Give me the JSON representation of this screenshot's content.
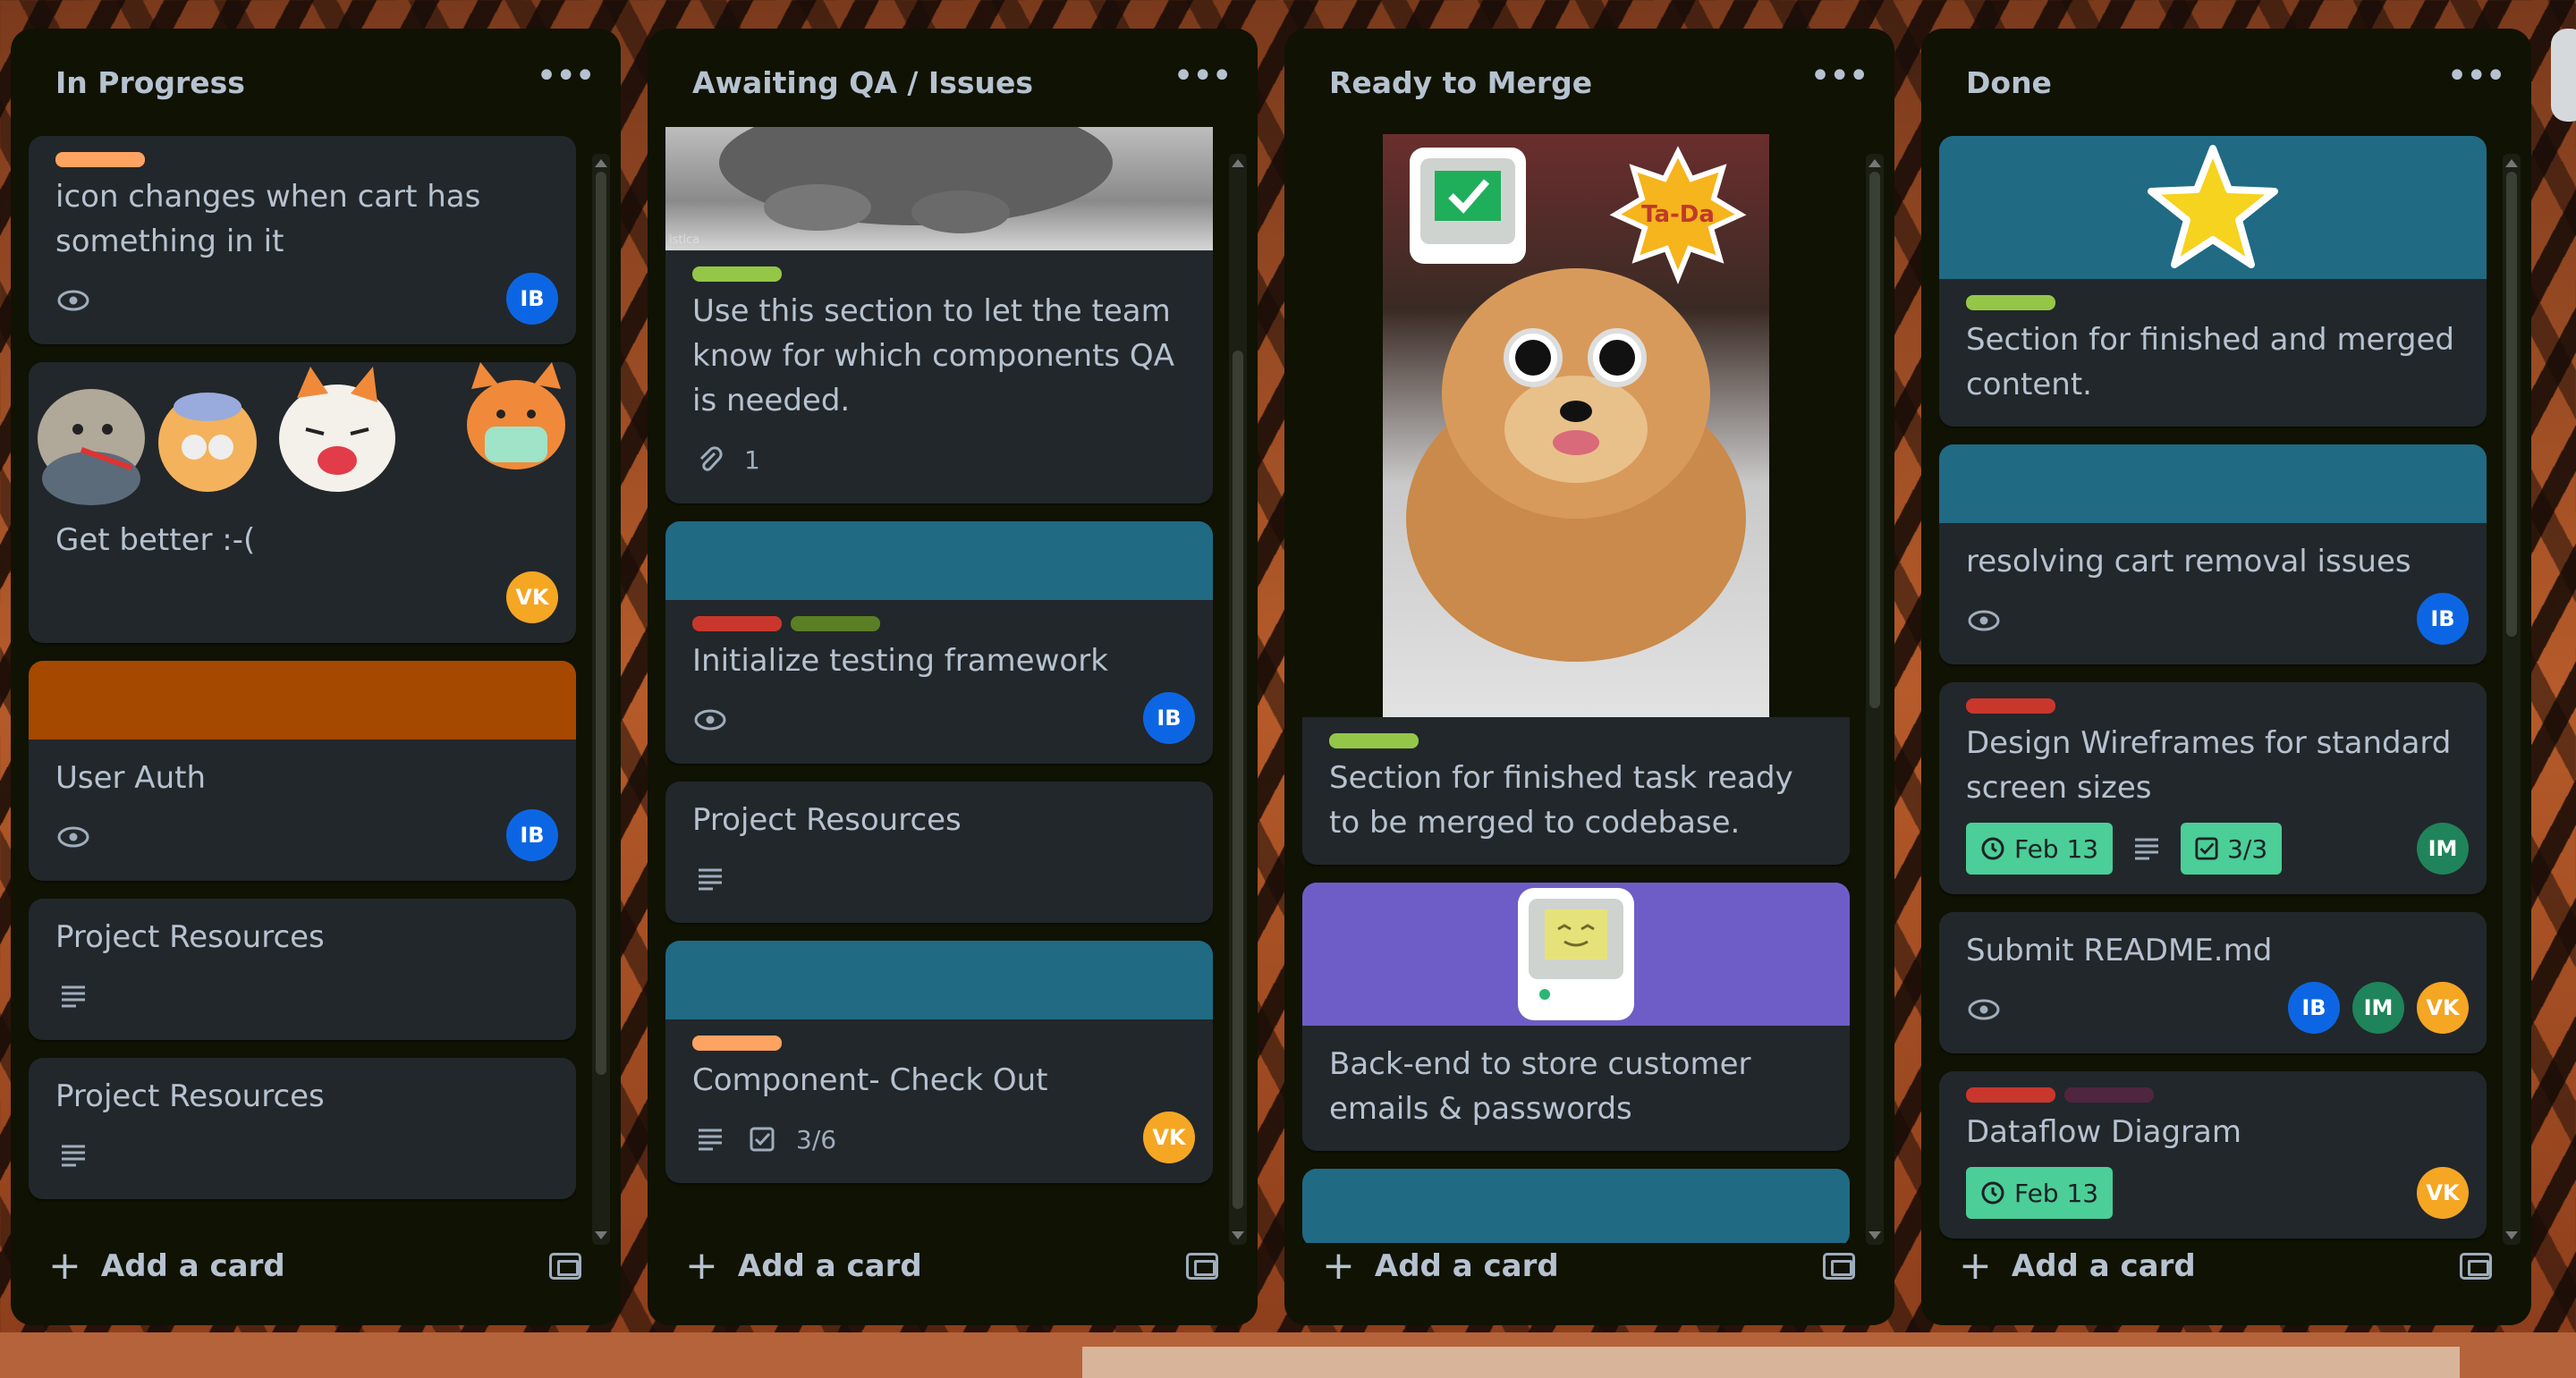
{
  "lists": [
    {
      "title": "In Progress",
      "cards": [
        {
          "title": "icon changes when cart has something in it",
          "label_colors": [
            "#fea362"
          ],
          "avatars": [
            "IB"
          ]
        },
        {
          "title": "Get better :-(",
          "avatars": [
            "VK"
          ]
        },
        {
          "title": "User Auth",
          "cover_color": "#a54800",
          "avatars": [
            "IB"
          ]
        },
        {
          "title": "Project Resources"
        },
        {
          "title": "Project Resources"
        }
      ],
      "add_label": "Add a card"
    },
    {
      "title": "Awaiting QA / Issues",
      "cards": [
        {
          "title": "Use this section to let the team know for which components QA is needed.",
          "label_colors": [
            "#94c748"
          ],
          "attachments": "1",
          "cover_image_text": "istica"
        },
        {
          "title": "Initialize testing framework",
          "cover_color": "#206a83",
          "label_colors": [
            "#c9372c",
            "#5b7f24"
          ],
          "avatars": [
            "IB"
          ]
        },
        {
          "title": "Project Resources"
        },
        {
          "title": "Component- Check Out",
          "cover_color": "#206a83",
          "label_colors": [
            "#fea362"
          ],
          "checklist": "3/6",
          "avatars": [
            "VK"
          ]
        }
      ],
      "add_label": "Add a card"
    },
    {
      "title": "Ready to Merge",
      "cards": [
        {
          "title": "Section for finished task ready to be merged to codebase.",
          "label_colors": [
            "#94c748"
          ],
          "sticker_text": "Ta-Da"
        },
        {
          "title": "Back-end to store customer emails & passwords",
          "cover_color": "#6e5dc6"
        },
        {
          "title": "",
          "cover_color": "#206a83"
        }
      ],
      "add_label": "Add a card"
    },
    {
      "title": "Done",
      "cards": [
        {
          "title": "Section for finished and merged content.",
          "cover_color": "#206a83",
          "label_colors": [
            "#94c748"
          ]
        },
        {
          "title": "resolving cart removal issues",
          "cover_color": "#206a83",
          "avatars": [
            "IB"
          ]
        },
        {
          "title": "Design Wireframes for standard screen sizes",
          "label_colors": [
            "#c9372c"
          ],
          "due": "Feb 13",
          "checklist": "3/3",
          "avatars": [
            "IM"
          ]
        },
        {
          "title": "Submit README.md",
          "avatars": [
            "IB",
            "IM",
            "VK"
          ]
        },
        {
          "title": "Dataflow Diagram",
          "label_colors": [
            "#c9372c",
            "#50253f"
          ],
          "due": "Feb 13",
          "avatars": [
            "VK"
          ]
        }
      ],
      "add_label": "Add a card"
    }
  ],
  "avatar_colors": {
    "IB": "#0c66e4",
    "VK": "#f5a623",
    "IM": "#1f845a"
  }
}
